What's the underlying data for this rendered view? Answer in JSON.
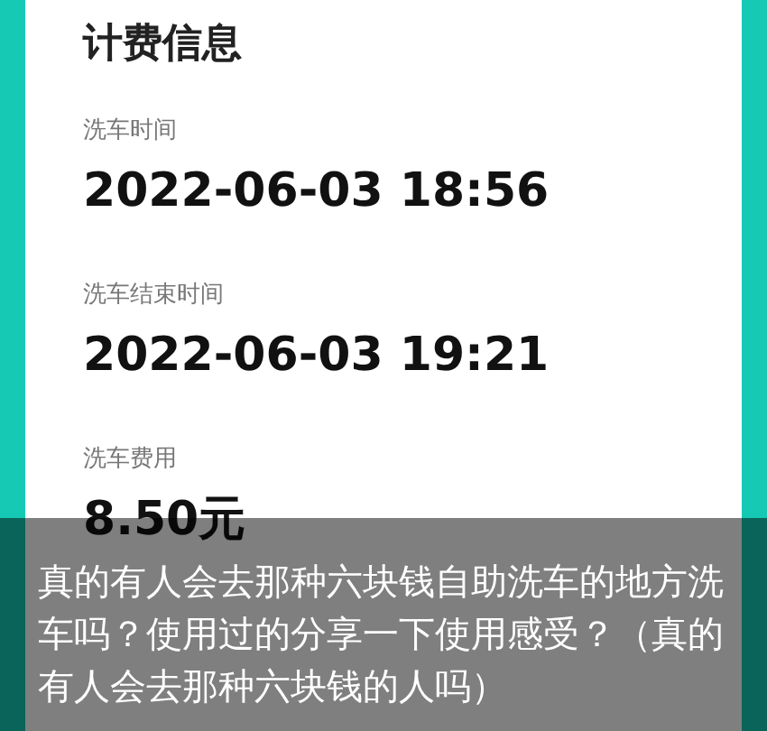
{
  "section_title": "计费信息",
  "fields": [
    {
      "label": "洗车时间",
      "value": "2022-06-03 18:56"
    },
    {
      "label": "洗车结束时间",
      "value": "2022-06-03 19:21"
    },
    {
      "label": "洗车费用",
      "value": "8.50元"
    }
  ],
  "caption": "真的有人会去那种六块钱自助洗车的地方洗车吗？使用过的分享一下使用感受？（真的有人会去那种六块钱的人吗）"
}
